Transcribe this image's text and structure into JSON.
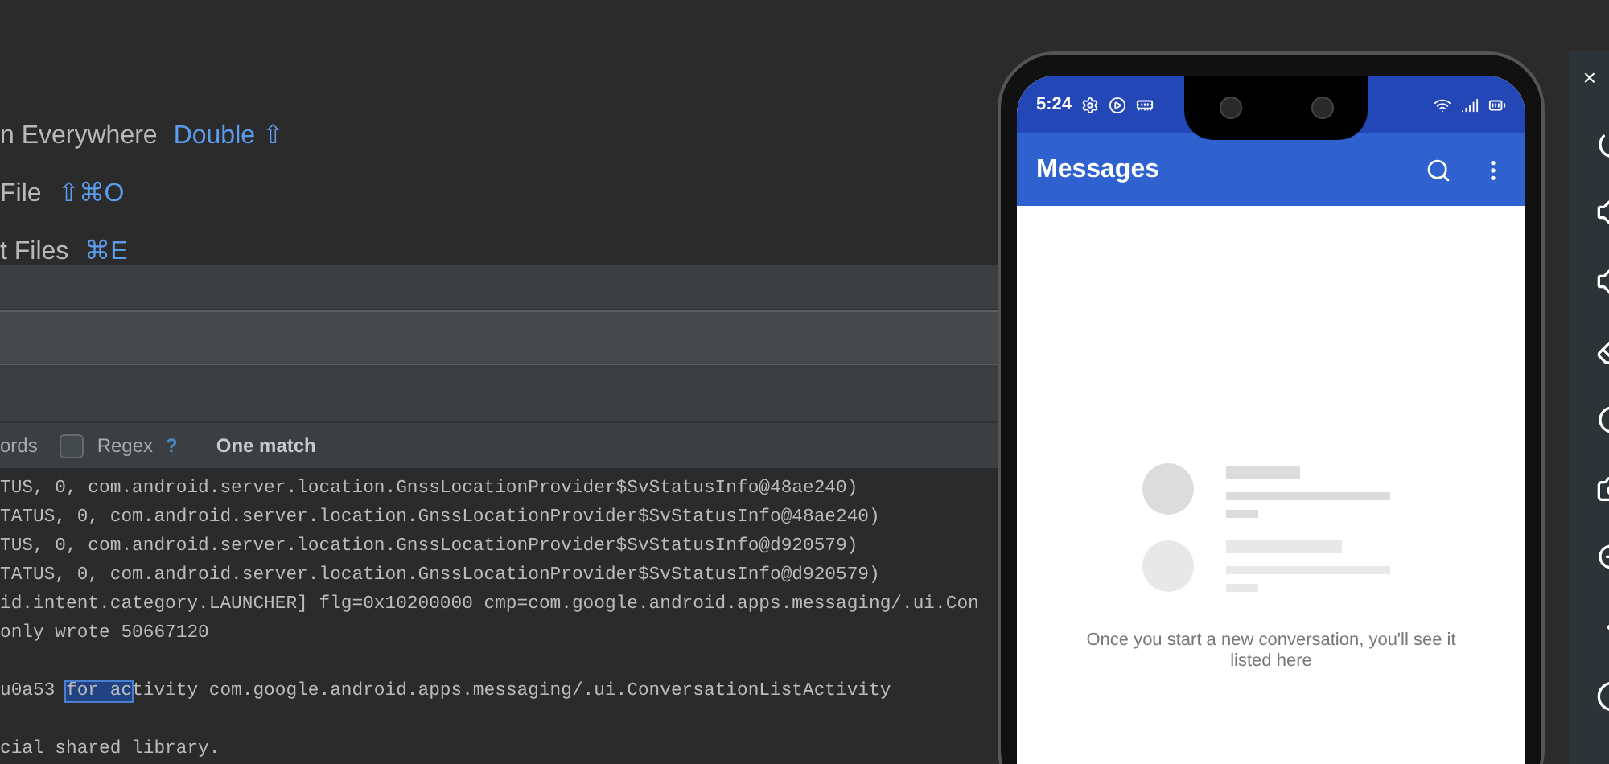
{
  "hints": [
    {
      "label": "n Everywhere",
      "shortcut": "Double ⇧"
    },
    {
      "label": "File",
      "shortcut": "⇧⌘O"
    },
    {
      "label": "t Files",
      "shortcut": "⌘E"
    }
  ],
  "find_options": {
    "words_label": "ords",
    "regex": {
      "label": "Regex",
      "checked": false
    },
    "help": "?",
    "status": "One match"
  },
  "log_blocks": [
    [
      {
        "parts": [
          {
            "text": "TUS, 0, com.android.server.location.GnssLocationProvider$SvStatusInfo@48ae240)",
            "selected": false
          }
        ]
      },
      {
        "parts": [
          {
            "text": "TATUS, 0, com.android.server.location.GnssLocationProvider$SvStatusInfo@48ae240)",
            "selected": false
          }
        ]
      },
      {
        "parts": [
          {
            "text": "TUS, 0, com.android.server.location.GnssLocationProvider$SvStatusInfo@d920579)",
            "selected": false
          }
        ]
      },
      {
        "parts": [
          {
            "text": "TATUS, 0, com.android.server.location.GnssLocationProvider$SvStatusInfo@d920579)",
            "selected": false
          }
        ]
      },
      {
        "parts": [
          {
            "text": "id.intent.category.LAUNCHER] flg=0x10200000 cmp=com.google.android.apps.messaging/.ui.Con",
            "selected": false
          }
        ]
      },
      {
        "parts": [
          {
            "text": "only wrote 50667120",
            "selected": false
          }
        ]
      }
    ],
    [
      {
        "parts": [
          {
            "text": "u0a53 ",
            "selected": false
          },
          {
            "text": "for ac",
            "selected": true
          },
          {
            "text": "tivity com.google.android.apps.messaging/.ui.ConversationListActivity",
            "selected": false
          }
        ]
      }
    ],
    [
      {
        "parts": [
          {
            "text": "cial shared library.",
            "selected": false
          }
        ]
      }
    ]
  ],
  "phone": {
    "status_time": "5:24",
    "app_title": "Messages",
    "empty_message": "Once you start a new conversation, you'll see it listed here"
  },
  "emulator_toolbar": {
    "close": "×"
  }
}
